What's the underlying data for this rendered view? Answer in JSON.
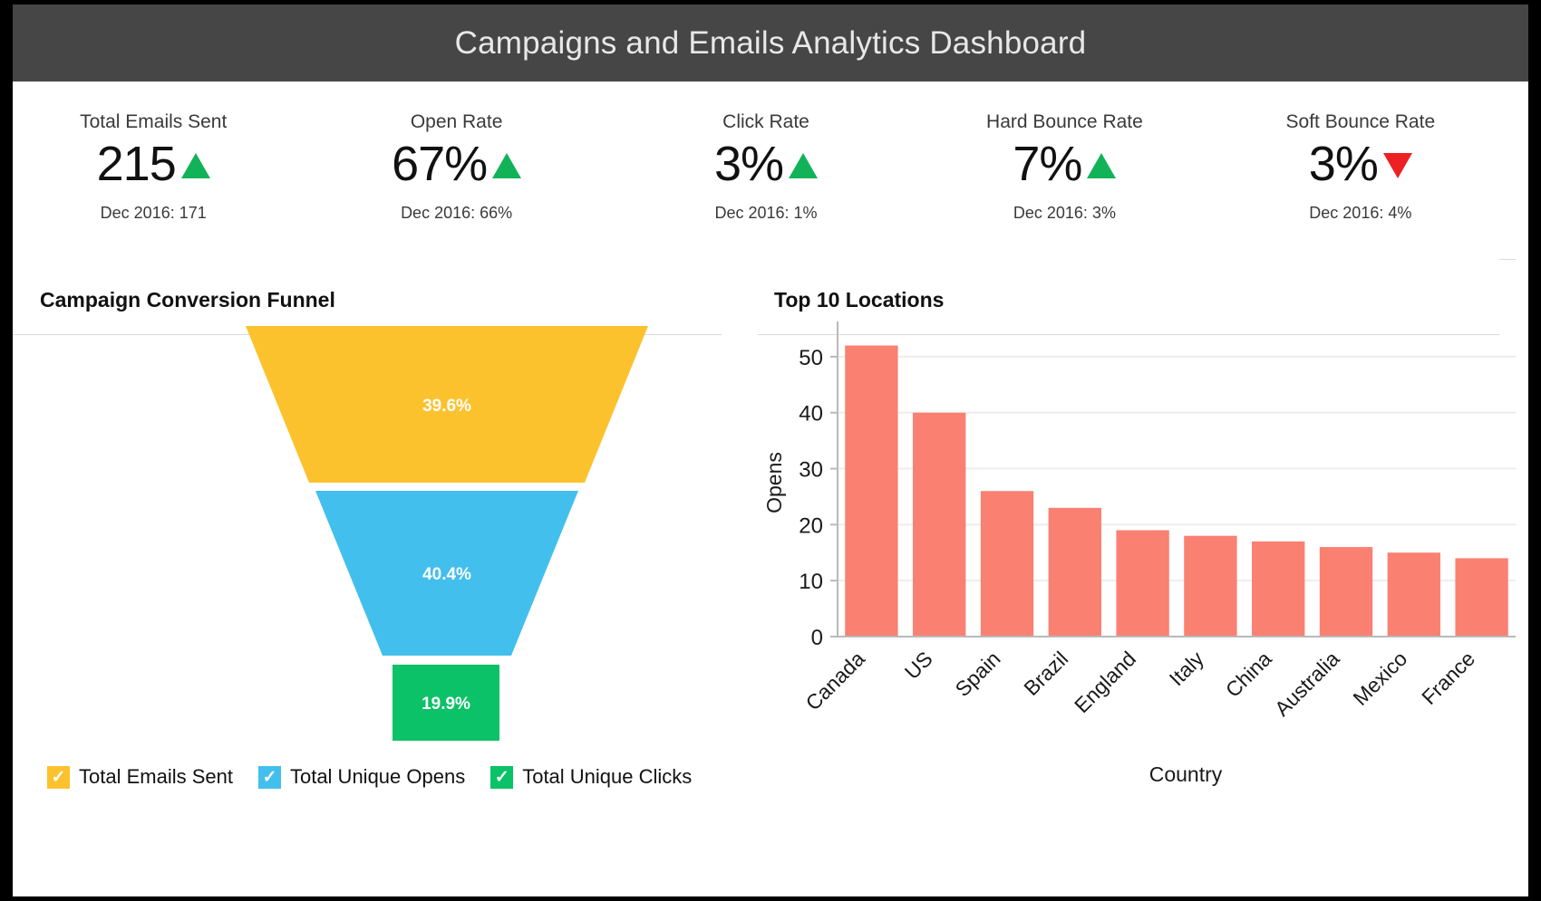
{
  "header": {
    "title": "Campaigns and Emails Analytics Dashboard"
  },
  "kpis": [
    {
      "label": "Total Emails Sent",
      "value": "215",
      "trend": "up",
      "previous": "Dec 2016: 171"
    },
    {
      "label": "Open Rate",
      "value": "67%",
      "trend": "up",
      "previous": "Dec 2016: 66%"
    },
    {
      "label": "Click Rate",
      "value": "3%",
      "trend": "up",
      "previous": "Dec 2016: 1%"
    },
    {
      "label": "Hard Bounce Rate",
      "value": "7%",
      "trend": "up",
      "previous": "Dec 2016: 3%"
    },
    {
      "label": "Soft Bounce Rate",
      "value": "3%",
      "trend": "down",
      "previous": "Dec 2016: 4%"
    }
  ],
  "colors": {
    "trend_up": "#12b259",
    "trend_down": "#ed2024",
    "funnel_stage_1": "#fcc22e",
    "funnel_stage_2": "#42bfed",
    "funnel_stage_3": "#0bc268",
    "bar": "#fa8072",
    "title_bar": "#464646"
  },
  "funnel_panel": {
    "title": "Campaign Conversion Funnel",
    "legend": [
      {
        "label": "Total Emails Sent",
        "color": "#fcc22e",
        "icon": "checkmark"
      },
      {
        "label": "Total Unique Opens",
        "color": "#42bfed",
        "icon": "checkmark"
      },
      {
        "label": "Total Unique Clicks",
        "color": "#0bc268",
        "icon": "checkmark"
      }
    ]
  },
  "locations_panel": {
    "title": "Top 10 Locations"
  },
  "chart_data": [
    {
      "type": "funnel",
      "title": "Campaign Conversion Funnel",
      "stages": [
        {
          "name": "Total Emails Sent",
          "label": "39.6%",
          "value": 39.6,
          "color": "#fcc22e"
        },
        {
          "name": "Total Unique Opens",
          "label": "40.4%",
          "value": 40.4,
          "color": "#42bfed"
        },
        {
          "name": "Total Unique Clicks",
          "label": "19.9%",
          "value": 19.9,
          "color": "#0bc268"
        }
      ]
    },
    {
      "type": "bar",
      "title": "Top 10 Locations",
      "xlabel": "Country",
      "ylabel": "Opens",
      "categories": [
        "Canada",
        "US",
        "Spain",
        "Brazil",
        "England",
        "Italy",
        "China",
        "Australia",
        "Mexico",
        "France"
      ],
      "values": [
        52,
        40,
        26,
        23,
        19,
        18,
        17,
        16,
        15,
        14
      ],
      "ylim": [
        0,
        55
      ],
      "yticks": [
        0,
        10,
        20,
        30,
        40,
        50
      ],
      "grid": true,
      "legend": "none",
      "color": "#fa8072"
    }
  ]
}
